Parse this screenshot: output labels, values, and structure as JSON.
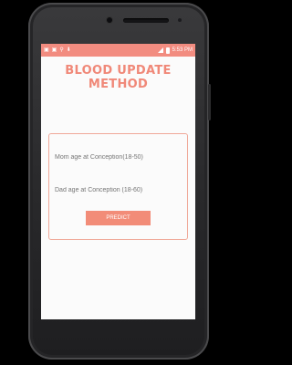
{
  "status_bar": {
    "time": "5:53 PM",
    "left_icons": [
      "notification-icon",
      "notification-icon",
      "usb-icon",
      "download-icon"
    ],
    "right_icons": [
      "signal-icon",
      "battery-icon"
    ]
  },
  "app": {
    "title": "BLOOD UPDATE METHOD"
  },
  "form": {
    "mom_age_placeholder": "Mom age at Conception(18-50)",
    "dad_age_placeholder": "Dad age at Conception (18-60)",
    "predict_label": "PREDICT"
  },
  "colors": {
    "accent": "#f28c80",
    "title": "#f08878",
    "card_border": "#f0a898"
  }
}
